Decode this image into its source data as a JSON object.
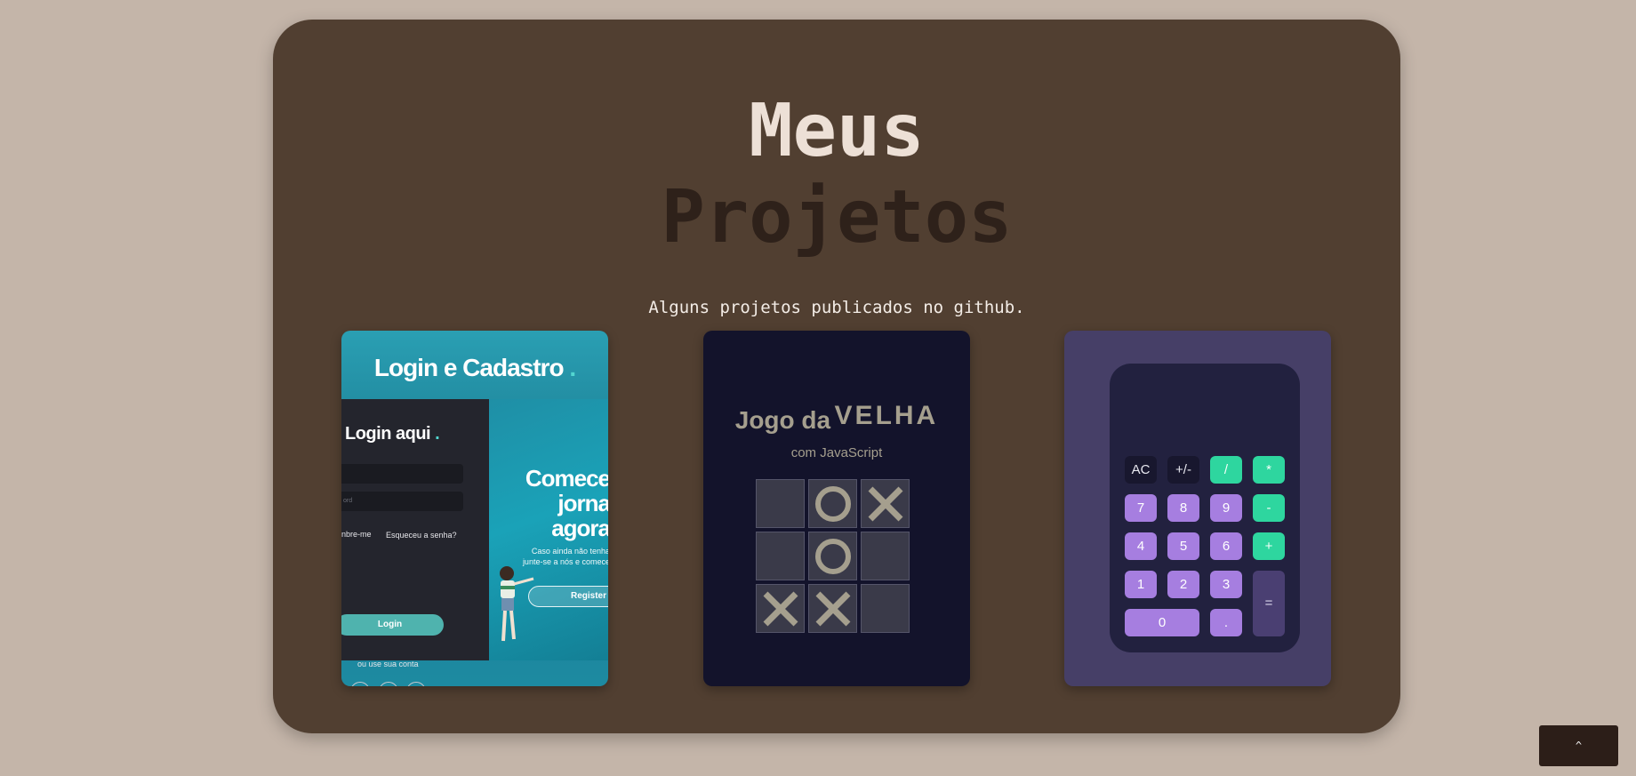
{
  "header": {
    "title_line1": "Meus",
    "title_line2": "Projetos",
    "subtitle": "Alguns projetos publicados no github."
  },
  "projects": {
    "login": {
      "title": "Login e Cadastro",
      "title_dot": ".",
      "login_heading": "Login aqui",
      "login_dot": ".",
      "password_placeholder": "ord",
      "remember_me": "nbre-me",
      "forgot_password": "Esqueceu a senha?",
      "login_button": "Login",
      "or_use": "ou use sua conta",
      "social": [
        "f",
        "G",
        "in"
      ],
      "right_title": "Comece\njorna\nagora",
      "right_text": "Caso ainda não tenha\njunte-se a nós e comece",
      "register_button": "Register"
    },
    "tictactoe": {
      "title_a": "Jogo da",
      "title_b": "VELHA",
      "subtitle": "com JavaScript",
      "board": [
        "",
        "O",
        "X",
        "",
        "O",
        "",
        "X",
        "X",
        ""
      ]
    },
    "calculator": {
      "buttons": [
        "AC",
        "+/-",
        "/",
        "*",
        "7",
        "8",
        "9",
        "-",
        "4",
        "5",
        "6",
        "+",
        "1",
        "2",
        "3",
        "=",
        "0",
        "."
      ]
    }
  },
  "scroll_top": {
    "label": "^"
  },
  "colors": {
    "page_bg": "#c4b5a9",
    "panel_bg": "#513f31",
    "calc_operator": "#2ed69f",
    "calc_number": "#a67ee0",
    "ttt_bg": "#13132b",
    "ttt_mark": "#a59f8e"
  }
}
